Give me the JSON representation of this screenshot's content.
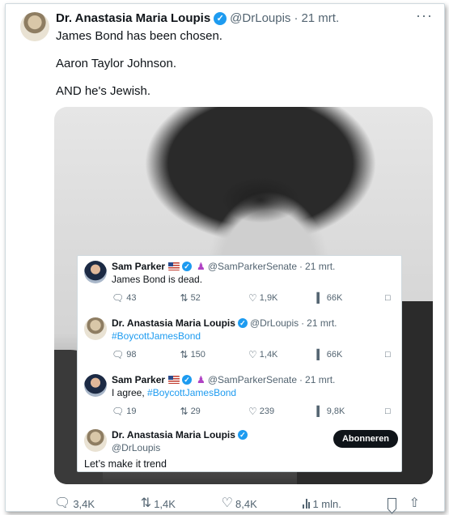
{
  "tweet": {
    "author_name": "Dr. Anastasia Maria Loupis",
    "handle": "@DrLoupis",
    "date": "21 mrt.",
    "verified_mark": "✓",
    "more": "···",
    "lines": [
      "James Bond has been chosen.",
      "Aaron Taylor Johnson.",
      "AND he's Jewish."
    ],
    "stats": {
      "replies": "3,4K",
      "reposts": "1,4K",
      "likes": "8,4K",
      "views": "1 mln."
    }
  },
  "thread": {
    "post1": {
      "name": "Sam Parker",
      "handle": "@SamParkerSenate",
      "date": "21 mrt.",
      "text": "James Bond is dead.",
      "stats": {
        "replies": "43",
        "reposts": "52",
        "likes": "1,9K",
        "views": "66K"
      }
    },
    "post2": {
      "name": "Dr. Anastasia Maria Loupis",
      "handle": "@DrLoupis",
      "date": "21 mrt.",
      "text": "#BoycottJamesBond",
      "stats": {
        "replies": "98",
        "reposts": "150",
        "likes": "1,4K",
        "views": "66K"
      }
    },
    "post3": {
      "name": "Sam Parker",
      "handle": "@SamParkerSenate",
      "date": "21 mrt.",
      "text_prefix": "I agree, ",
      "text_link": "#BoycottJamesBond",
      "stats": {
        "replies": "19",
        "reposts": "29",
        "likes": "239",
        "views": "9,8K"
      }
    },
    "post4": {
      "name": "Dr. Anastasia Maria Loupis",
      "handle": "@DrLoupis",
      "follow_label": "Abonneren",
      "text": "Let’s make it trend"
    },
    "sep": "·"
  },
  "icons": {
    "reply": "reply-icon",
    "repost": "repost-icon",
    "like": "heart-icon",
    "views": "views-icon",
    "bookmark": "bookmark-icon"
  },
  "colors": {
    "accent": "#1d9bf0",
    "text": "#0f1419",
    "muted": "#536471"
  }
}
